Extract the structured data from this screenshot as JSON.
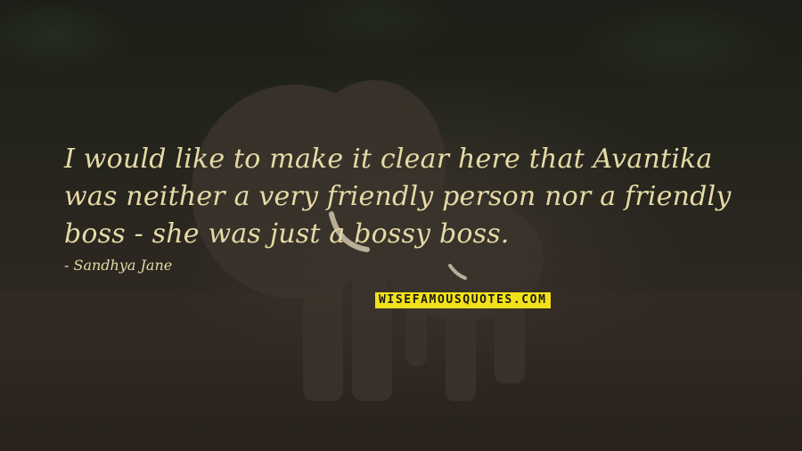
{
  "quote": {
    "text": "I would like to make it clear here that Avantika was neither a very friendly person nor a friendly boss - she was just a bossy boss.",
    "author": "- Sandhya Jane"
  },
  "brand": {
    "label": "WISEFAMOUSQUOTES.COM"
  },
  "colors": {
    "text": "#e6d9a6",
    "brand_bg": "#f2e11a",
    "background": "#241f19"
  }
}
